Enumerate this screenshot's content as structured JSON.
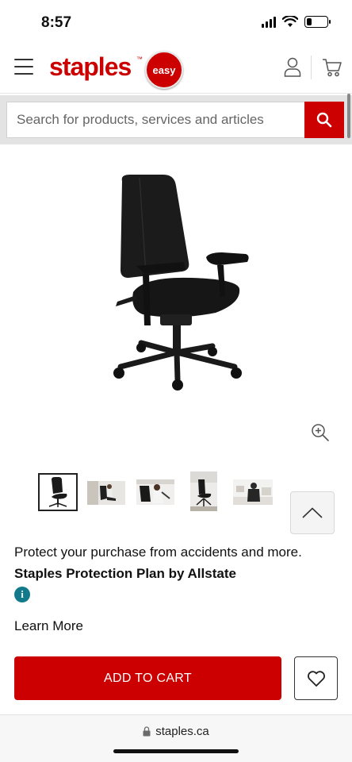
{
  "status_bar": {
    "time": "8:57",
    "battery_level": 0.25
  },
  "header": {
    "logo_text": "staples",
    "logo_tm": "™",
    "badge_text": "easy",
    "brand_color": "#cc0000"
  },
  "search": {
    "placeholder": "Search for products, services and articles"
  },
  "gallery": {
    "thumbnails": [
      {
        "description": "chair-front",
        "selected": true
      },
      {
        "description": "woman-seated-chair",
        "selected": false
      },
      {
        "description": "woman-adjusting-chair",
        "selected": false
      },
      {
        "description": "chair-in-office",
        "selected": false
      },
      {
        "description": "person-at-desk-back",
        "selected": false
      }
    ]
  },
  "protection": {
    "intro": "Protect your purchase from accidents and more.",
    "plan_name": "Staples Protection Plan by Allstate",
    "info_glyph": "i",
    "learn_more": "Learn More"
  },
  "actions": {
    "add_to_cart": "ADD TO CART"
  },
  "browser": {
    "url": "staples.ca"
  }
}
